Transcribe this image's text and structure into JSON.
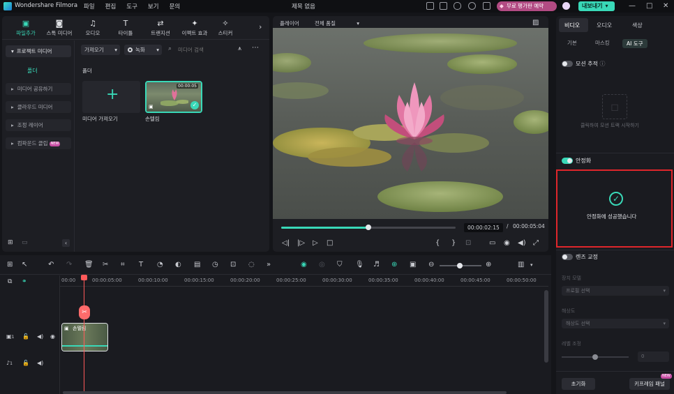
{
  "titlebar": {
    "app_name": "Wondershare Filmora",
    "menu": [
      "파일",
      "편집",
      "도구",
      "보기",
      "문의"
    ],
    "doc_title": "제목 없음",
    "upgrade_label": "무료 평가판 예약",
    "export_label": "내보내기"
  },
  "media_tabs": [
    {
      "label": "파일추가",
      "icon": "import-icon",
      "glyph": "▣"
    },
    {
      "label": "스톡 미디어",
      "icon": "stock-media-icon",
      "glyph": "◙"
    },
    {
      "label": "오디오",
      "icon": "music-note-icon",
      "glyph": "♫"
    },
    {
      "label": "타이틀",
      "icon": "title-t-icon",
      "glyph": "T"
    },
    {
      "label": "트랜지션",
      "icon": "transition-icon",
      "glyph": "⇄"
    },
    {
      "label": "이펙트 효과",
      "icon": "effects-sparkle-icon",
      "glyph": "✦"
    },
    {
      "label": "스티커",
      "icon": "sticker-icon",
      "glyph": "✧"
    }
  ],
  "sidebar": {
    "header": "프로젝트 미디어",
    "folder": "폴더",
    "items": [
      {
        "label": "미디어 공유하기",
        "badge": ""
      },
      {
        "label": "클라우드 미디어",
        "badge": ""
      },
      {
        "label": "조정 레이어",
        "badge": ""
      },
      {
        "label": "컴파운드 클립",
        "badge": "NEW"
      }
    ]
  },
  "media_toolbar": {
    "import_dropdown": "가져오기",
    "record_dropdown": "녹화",
    "search_placeholder": "미디어 검색"
  },
  "media_area": {
    "folder_label": "폴더",
    "import_tile_label": "미디어 가져오기",
    "clip_name": "손텔림",
    "clip_duration": "00:00:05"
  },
  "preview": {
    "player_label": "플레이어",
    "quality": "전체 품질",
    "current_time": "00:00:02:15",
    "separator": "/",
    "total_time": "00:00:05:04",
    "progress": 0.5
  },
  "right_panel": {
    "tabs": [
      "비디오",
      "오디오",
      "색상"
    ],
    "subtabs": [
      "기본",
      "마스킹",
      "AI 도구"
    ],
    "motion_tracking_label": "모션 추적",
    "motion_tracking_hint": "클릭하여 모션 트랙 시작하기",
    "stabilization_label": "안정화",
    "stabilization_success": "안정화에 성공했습니다",
    "lens_correction_label": "렌즈 교정",
    "device_model_label": "장치 모델",
    "device_model_placeholder": "프로필 선택",
    "resolution_label": "해상도",
    "resolution_placeholder": "해상도 선택",
    "level_label": "레벨 조정",
    "level_value": "0",
    "reset_label": "초기화",
    "keyframe_label": "키프레임 패널",
    "keyframe_badge": "NEW"
  },
  "timeline": {
    "ruler": [
      "00:00",
      "00:00:05:00",
      "00:00:10:00",
      "00:00:15:00",
      "00:00:20:00",
      "00:00:25:00",
      "00:00:30:00",
      "00:00:35:00",
      "00:00:40:00",
      "00:00:45:00",
      "00:00:50:00"
    ],
    "video_track_num": "1",
    "audio_track_num": "1",
    "clip_label": "손텔림"
  },
  "colors": {
    "accent": "#39d9b8",
    "highlight_box": "#e0262b",
    "playhead": "#ff5a5a"
  }
}
